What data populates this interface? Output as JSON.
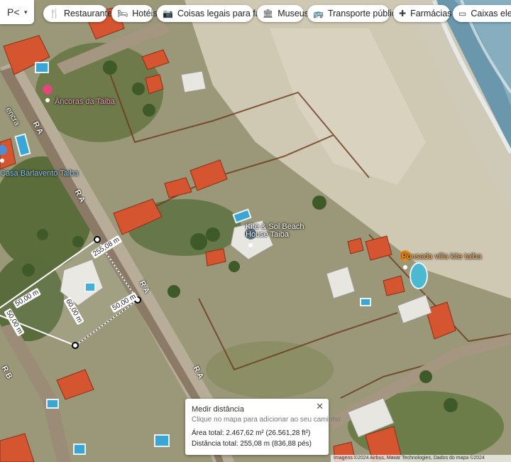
{
  "layer_button": {
    "label": "P<",
    "arrow": "▾"
  },
  "chips": [
    {
      "icon": "restaurant-icon",
      "glyph": "🍴",
      "label": "Restaurantes"
    },
    {
      "icon": "hotel-icon",
      "glyph": "🛏",
      "label": "Hotéis"
    },
    {
      "icon": "camera-icon",
      "glyph": "📷",
      "label": "Coisas legais para fa..."
    },
    {
      "icon": "museum-icon",
      "glyph": "🏛",
      "label": "Museus"
    },
    {
      "icon": "bus-icon",
      "glyph": "🚌",
      "label": "Transporte público"
    },
    {
      "icon": "pharmacy-icon",
      "glyph": "✚",
      "label": "Farmácias"
    },
    {
      "icon": "atm-icon",
      "glyph": "▭",
      "label": "Caixas eletrô"
    }
  ],
  "road_labels": [
    "R A",
    "R A",
    "R A",
    "R A",
    "R B",
    "R A"
  ],
  "places": [
    {
      "name": "Âncoras da Taiba",
      "color": "#f3a6c0"
    },
    {
      "name": "Casa Barlavento Taiba",
      "color": "#8fd3ff"
    },
    {
      "name": "Kite & Sol Beach House Taiba",
      "color": "#ffffff"
    },
    {
      "name": "Pousada villa kite taiba",
      "color": "#f6b26b"
    },
    {
      "name": "encra",
      "color": "#ffffff"
    }
  ],
  "measurements": [
    "255,08 m",
    "60,00 m",
    "50,00 m",
    "50,00 m",
    "50,00 m"
  ],
  "measure_panel": {
    "title": "Medir distância",
    "hint": "Clique no mapa para adicionar ao seu caminho",
    "area": "Área total: 2.467,62 m² (26.561,28 ft²)",
    "distance": "Distância total: 255,08 m (836,88 pés)",
    "close": "✕"
  },
  "attribution": "Imagens ©2024 Airbus, Maxar Technologies, Dados do mapa ©2024",
  "colors": {
    "sand": "#d9d2c2",
    "ocean": "#5f8fa5",
    "road": "#6a5a4a",
    "roof": "#d4552f",
    "vegetation": "#4f6b34",
    "lot_line": "#6b3a1e"
  }
}
